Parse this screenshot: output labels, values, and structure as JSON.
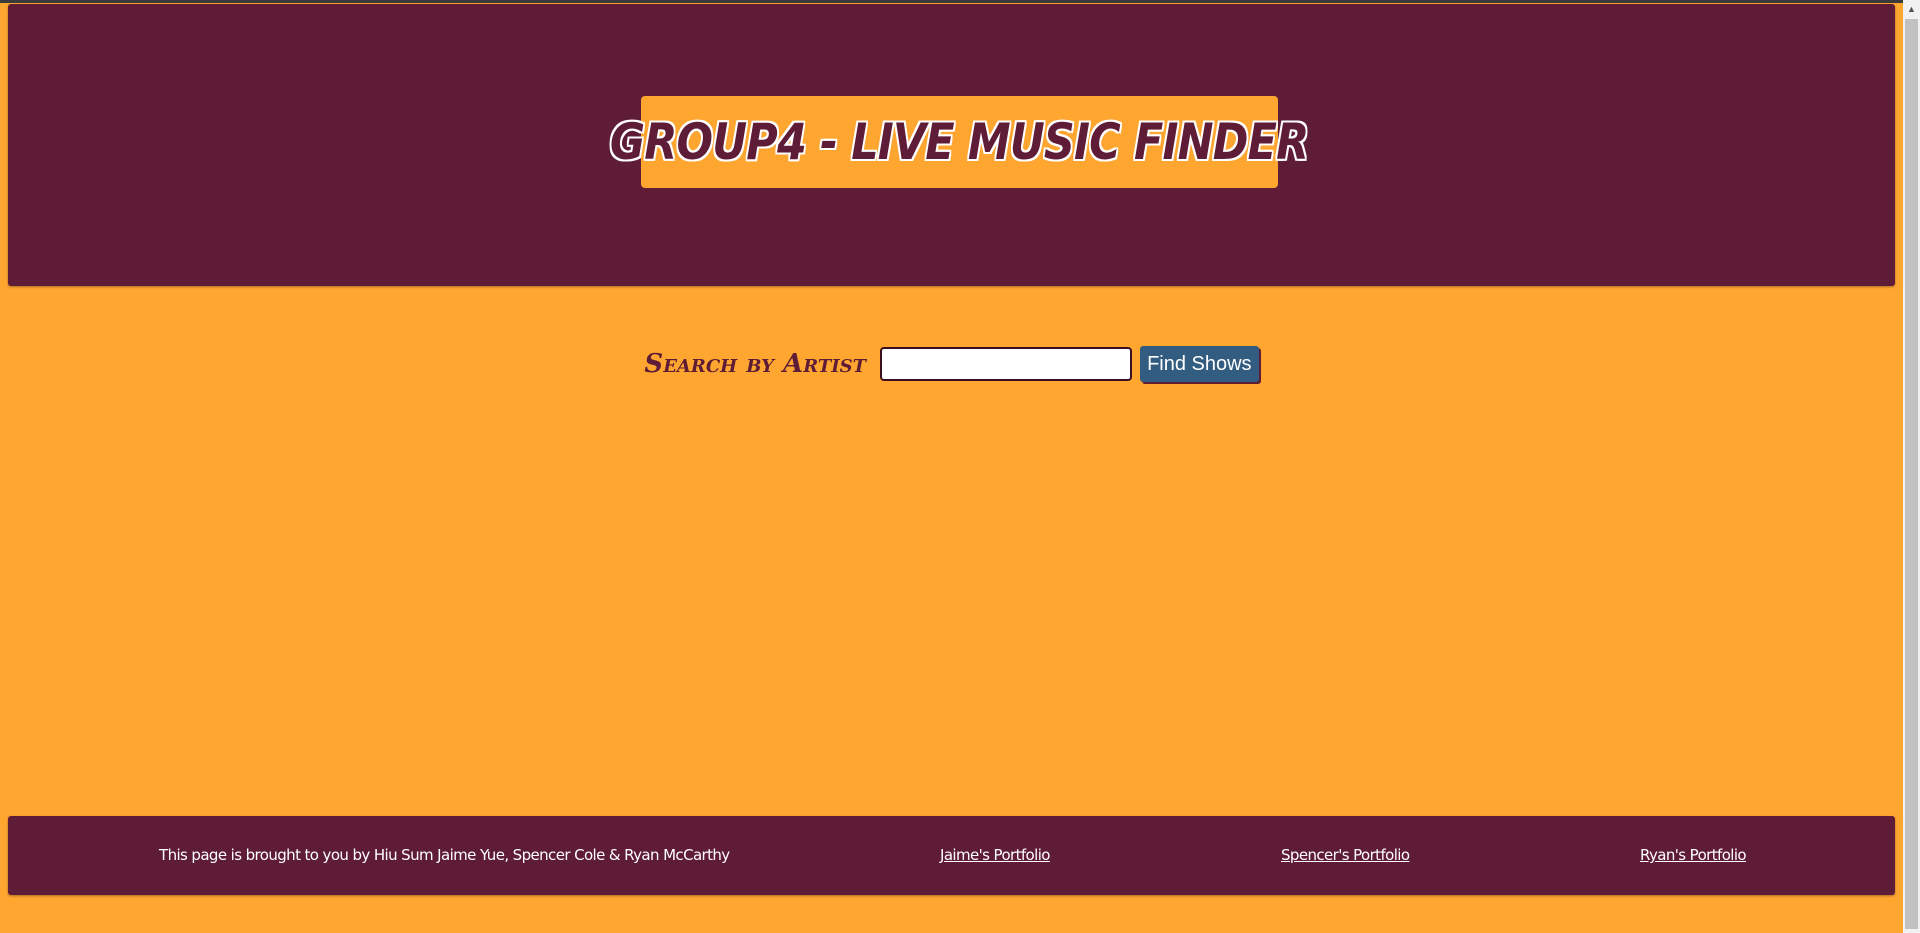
{
  "header": {
    "title": "Group4 - Live Music Finder"
  },
  "search": {
    "label": "Search by Artist",
    "input_value": "",
    "placeholder": "",
    "button_label": "Find Shows"
  },
  "footer": {
    "credit": "This page is brought to you by Hiu Sum Jaime Yue, Spencer Cole & Ryan McCarthy",
    "links": [
      {
        "label": "Jaime's Portfolio"
      },
      {
        "label": "Spencer's Portfolio"
      },
      {
        "label": "Ryan's Portfolio"
      }
    ]
  },
  "colors": {
    "background": "#FFA630",
    "primary": "#5E1C36",
    "button": "#335C81",
    "text_light": "#FFFFFF"
  },
  "icons": {
    "scroll_up": "scroll-up-arrow-icon"
  }
}
